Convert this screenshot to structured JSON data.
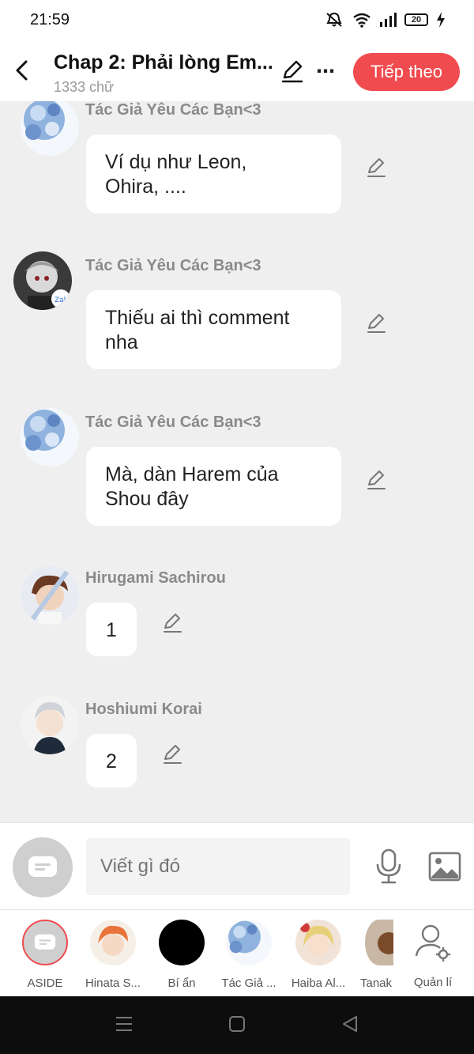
{
  "status": {
    "time": "21:59",
    "battery": "20"
  },
  "header": {
    "title": "Chap 2: Phải lòng Em...",
    "subtitle": "1333 chữ",
    "next_button": "Tiếp theo"
  },
  "messages": [
    {
      "sender": "Tác Giả Yêu Các Bạn<3",
      "text_lines": [
        "Ví dụ như Leon,",
        "Ohira, ...."
      ]
    },
    {
      "sender": "Tác Giả Yêu Các Bạn<3",
      "text_lines": [
        "Thiếu ai thì comment",
        "nha"
      ]
    },
    {
      "sender": "Tác Giả Yêu Các Bạn<3",
      "text_lines": [
        "Mà, dàn Harem của",
        "Shou đây"
      ]
    },
    {
      "sender": "Hirugami Sachirou",
      "text_lines": [
        "1"
      ]
    },
    {
      "sender": "Hoshiumi Korai",
      "text_lines": [
        "2"
      ]
    }
  ],
  "composer": {
    "placeholder": "Viết gì đó"
  },
  "tabs": [
    {
      "label": "ASIDE"
    },
    {
      "label": "Hinata S..."
    },
    {
      "label": "Bí ẩn"
    },
    {
      "label": "Tác Giả ..."
    },
    {
      "label": "Haiba Al..."
    },
    {
      "label": "Tanak"
    },
    {
      "label": "Quản lí"
    }
  ],
  "colors": {
    "accent": "#f04b4f",
    "chat_background": "#efefef"
  }
}
